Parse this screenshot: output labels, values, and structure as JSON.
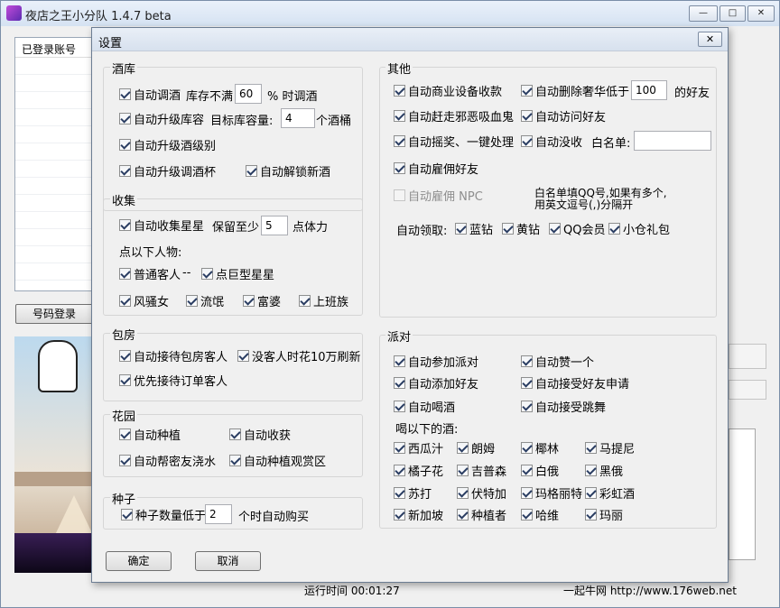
{
  "app": {
    "title": "夜店之王小分队 1.4.7 beta",
    "minimize_icon": "minimize-icon",
    "maximize_icon": "maximize-icon",
    "close_icon": "close-icon"
  },
  "account_list": {
    "header": "已登录账号"
  },
  "login_button": "号码登录",
  "status": {
    "runtime": "运行时间 00:01:27",
    "site": "一起牛网 http://www.176web.net"
  },
  "dialog": {
    "title": "设置",
    "close_icon": "close-icon",
    "ok": "确定",
    "cancel": "取消",
    "wine_cellar": {
      "title": "酒库",
      "auto_mix": {
        "label": "自动调酒",
        "checked": true
      },
      "stock_label": "库存不满",
      "stock_value": "60",
      "stock_suffix": "% 时调酒",
      "auto_upgrade_cellar": {
        "label": "自动升级库容",
        "checked": true
      },
      "target_label": "目标库容量:",
      "target_value": "4",
      "target_suffix": "个酒桶",
      "auto_upgrade_level": {
        "label": "自动升级酒级别",
        "checked": true
      },
      "auto_upgrade_cup": {
        "label": "自动升级调酒杯",
        "checked": true
      },
      "auto_unlock": {
        "label": "自动解锁新酒",
        "checked": true
      }
    },
    "collect": {
      "title": "收集",
      "auto_collect": {
        "label": "自动收集星星",
        "checked": true
      },
      "keep_label": "保留至少",
      "keep_value": "5",
      "keep_suffix": "点体力",
      "click_people_label": "点以下人物:",
      "normal_guest": {
        "label": "普通客人",
        "checked": true
      },
      "dash": "--",
      "big_star": {
        "label": "点巨型星星",
        "checked": true
      },
      "people": [
        {
          "label": "风骚女",
          "checked": true
        },
        {
          "label": "流氓",
          "checked": true
        },
        {
          "label": "富婆",
          "checked": true
        },
        {
          "label": "上班族",
          "checked": true
        }
      ]
    },
    "private_room": {
      "title": "包房",
      "auto_receive": {
        "label": "自动接待包房客人",
        "checked": true
      },
      "refresh": {
        "label": "没客人时花10万刷新",
        "checked": true
      },
      "priority_order": {
        "label": "优先接待订单客人",
        "checked": true
      }
    },
    "garden": {
      "title": "花园",
      "auto_plant": {
        "label": "自动种植",
        "checked": true
      },
      "auto_harvest": {
        "label": "自动收获",
        "checked": true
      },
      "auto_water": {
        "label": "自动帮密友浇水",
        "checked": true
      },
      "auto_plant_view": {
        "label": "自动种植观赏区",
        "checked": true
      }
    },
    "seeds": {
      "title": "种子",
      "seed_low": {
        "label": "种子数量低于",
        "checked": true
      },
      "seed_value": "2",
      "seed_suffix": "个时自动购买"
    },
    "other": {
      "title": "其他",
      "auto_business": {
        "label": "自动商业设备收款",
        "checked": true
      },
      "auto_delete": {
        "label": "自动删除奢华低于",
        "checked": true
      },
      "delete_value": "100",
      "delete_suffix": "的好友",
      "auto_chase": {
        "label": "自动赶走邪恶吸血鬼",
        "checked": true
      },
      "auto_visit": {
        "label": "自动访问好友",
        "checked": true
      },
      "auto_lottery": {
        "label": "自动摇奖、一键处理",
        "checked": true
      },
      "auto_confiscate": {
        "label": "自动没收",
        "checked": true
      },
      "whitelist_label": "白名单:",
      "whitelist_value": "",
      "auto_hire_friend": {
        "label": "自动雇佣好友",
        "checked": true
      },
      "auto_hire_npc": {
        "label": "自动雇佣 NPC",
        "checked": false
      },
      "whitelist_hint_1": "白名单填QQ号,如果有多个,",
      "whitelist_hint_2": "用英文逗号(,)分隔开",
      "auto_claim_label": "自动领取:",
      "claims": [
        {
          "label": "蓝钻",
          "checked": true
        },
        {
          "label": "黄钻",
          "checked": true
        },
        {
          "label": "QQ会员",
          "checked": true
        },
        {
          "label": "小仓礼包",
          "checked": true
        }
      ]
    },
    "party": {
      "title": "派对",
      "auto_join": {
        "label": "自动参加派对",
        "checked": true
      },
      "auto_like": {
        "label": "自动赞一个",
        "checked": true
      },
      "auto_add_friend": {
        "label": "自动添加好友",
        "checked": true
      },
      "auto_accept_friend": {
        "label": "自动接受好友申请",
        "checked": true
      },
      "auto_drink": {
        "label": "自动喝酒",
        "checked": true
      },
      "auto_accept_dance": {
        "label": "自动接受跳舞",
        "checked": true
      },
      "drink_label": "喝以下的酒:",
      "drinks": [
        {
          "label": "西瓜汁",
          "checked": true
        },
        {
          "label": "朗姆",
          "checked": true
        },
        {
          "label": "椰林",
          "checked": true
        },
        {
          "label": "马提尼",
          "checked": true
        },
        {
          "label": "橘子花",
          "checked": true
        },
        {
          "label": "吉普森",
          "checked": true
        },
        {
          "label": "白俄",
          "checked": true
        },
        {
          "label": "黑俄",
          "checked": true
        },
        {
          "label": "苏打",
          "checked": true
        },
        {
          "label": "伏特加",
          "checked": true
        },
        {
          "label": "玛格丽特",
          "checked": true
        },
        {
          "label": "彩虹酒",
          "checked": true
        },
        {
          "label": "新加坡",
          "checked": true
        },
        {
          "label": "种植者",
          "checked": true
        },
        {
          "label": "哈维",
          "checked": true
        },
        {
          "label": "玛丽",
          "checked": true
        }
      ]
    }
  }
}
